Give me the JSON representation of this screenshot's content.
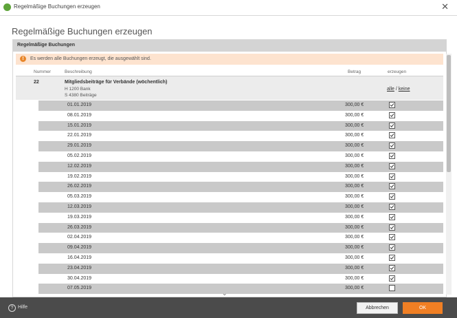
{
  "window": {
    "title": "Regelmäßige Buchungen erzeugen"
  },
  "dialog": {
    "heading": "Regelmäßige Buchungen erzeugen"
  },
  "section": {
    "title": "Regelmäßige Buchungen"
  },
  "info": {
    "text": "Es werden alle Buchungen erzeugt, die ausgewählt sind."
  },
  "columns": {
    "number": "Nummer",
    "description": "Beschreibung",
    "amount": "Betrag",
    "create": "erzeugen"
  },
  "group": {
    "number": "22",
    "title": "Mitgliedsbeiträge für Verbände (wöchentlich)",
    "debit": "H 1200 Bank",
    "credit": "S 4380 Beiträge",
    "link_all": "alle",
    "link_sep": "/",
    "link_none": "keine"
  },
  "rows": [
    {
      "date": "01.01.2019",
      "amount": "300,00 €",
      "checked": true
    },
    {
      "date": "08.01.2019",
      "amount": "300,00 €",
      "checked": true
    },
    {
      "date": "15.01.2019",
      "amount": "300,00 €",
      "checked": true
    },
    {
      "date": "22.01.2019",
      "amount": "300,00 €",
      "checked": true
    },
    {
      "date": "29.01.2019",
      "amount": "300,00 €",
      "checked": true
    },
    {
      "date": "05.02.2019",
      "amount": "300,00 €",
      "checked": true
    },
    {
      "date": "12.02.2019",
      "amount": "300,00 €",
      "checked": true
    },
    {
      "date": "19.02.2019",
      "amount": "300,00 €",
      "checked": true
    },
    {
      "date": "26.02.2019",
      "amount": "300,00 €",
      "checked": true
    },
    {
      "date": "05.03.2019",
      "amount": "300,00 €",
      "checked": true
    },
    {
      "date": "12.03.2019",
      "amount": "300,00 €",
      "checked": true
    },
    {
      "date": "19.03.2019",
      "amount": "300,00 €",
      "checked": true
    },
    {
      "date": "26.03.2019",
      "amount": "300,00 €",
      "checked": true
    },
    {
      "date": "02.04.2019",
      "amount": "300,00 €",
      "checked": true
    },
    {
      "date": "09.04.2019",
      "amount": "300,00 €",
      "checked": true
    },
    {
      "date": "16.04.2019",
      "amount": "300,00 €",
      "checked": true
    },
    {
      "date": "23.04.2019",
      "amount": "300,00 €",
      "checked": true
    },
    {
      "date": "30.04.2019",
      "amount": "300,00 €",
      "checked": true
    },
    {
      "date": "07.05.2019",
      "amount": "300,00 €",
      "checked": false
    }
  ],
  "footer": {
    "help": "Hilfe",
    "cancel": "Abbrechen",
    "ok": "OK"
  },
  "colors": {
    "accent": "#f07f24",
    "info_bg": "#fde3cf",
    "footer_bg": "#4b4b4b"
  }
}
